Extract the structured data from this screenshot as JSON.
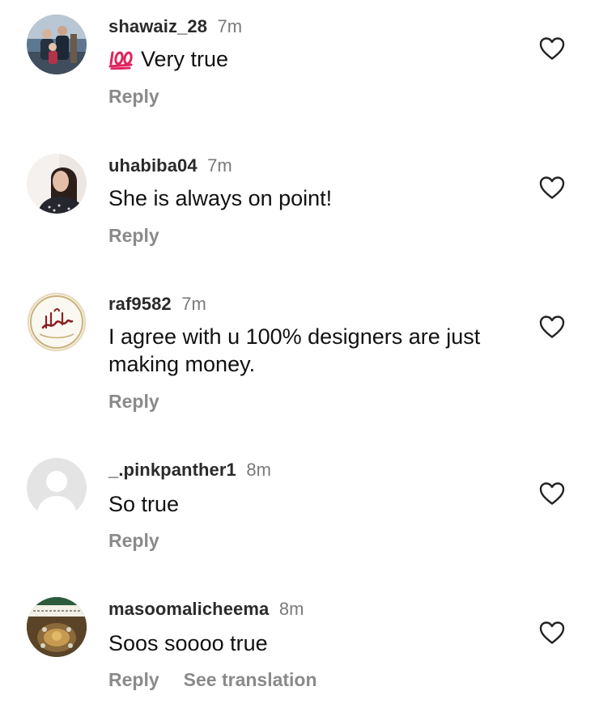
{
  "comments": [
    {
      "username": "shawaiz_28",
      "time": "7m",
      "emoji": "💯",
      "text": "Very true",
      "reply_label": "Reply",
      "avatar_icon": "family-photo-avatar",
      "like_icon": "heart-outline-icon"
    },
    {
      "username": "uhabiba04",
      "time": "7m",
      "text": "She is always on point!",
      "reply_label": "Reply",
      "avatar_icon": "woman-photo-avatar",
      "like_icon": "heart-outline-icon"
    },
    {
      "username": "raf9582",
      "time": "7m",
      "text": "I agree with u 100% designers are just making money.",
      "reply_label": "Reply",
      "avatar_icon": "calligraphy-avatar",
      "like_icon": "heart-outline-icon"
    },
    {
      "username": "_.pinkpanther1",
      "time": "8m",
      "text": "So true",
      "reply_label": "Reply",
      "avatar_icon": "default-user-avatar",
      "like_icon": "heart-outline-icon"
    },
    {
      "username": "masoomalicheema",
      "time": "8m",
      "text": "Soos soooo true",
      "reply_label": "Reply",
      "see_translation_label": "See translation",
      "avatar_icon": "shrine-photo-avatar",
      "like_icon": "heart-outline-icon"
    }
  ],
  "colors": {
    "username": "#2a2a2a",
    "timestamp": "#7a7a7a",
    "reply": "#8a8a8a",
    "heart_outline": "#222222"
  }
}
